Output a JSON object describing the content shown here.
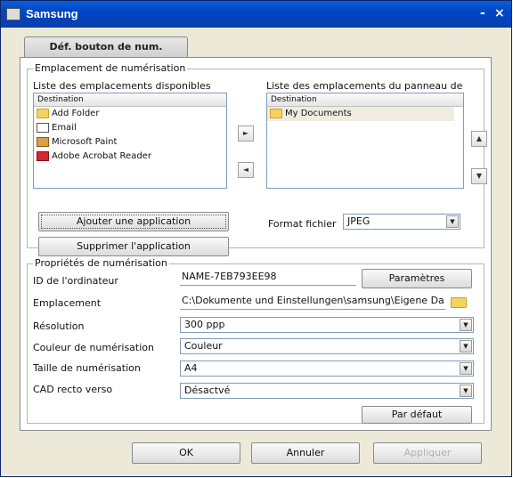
{
  "window": {
    "title": "Samsung",
    "minimize": "-",
    "close": "×"
  },
  "tab": {
    "label": "Déf. bouton de num."
  },
  "scan_location": {
    "legend": "Emplacement de numérisation",
    "available_label": "Liste des emplacements disponibles",
    "panel_label": "Liste des emplacements du panneau de",
    "column_header": "Destination",
    "available_items": [
      {
        "label": "Add Folder",
        "icon": "folder-icon"
      },
      {
        "label": "Email",
        "icon": "mail-icon"
      },
      {
        "label": "Microsoft Paint",
        "icon": "paint-icon"
      },
      {
        "label": "Adobe Acrobat Reader",
        "icon": "pdf-icon"
      }
    ],
    "panel_items": [
      {
        "label": "My Documents",
        "icon": "folder-icon"
      }
    ],
    "move_right": "►",
    "move_left": "◄",
    "move_up": "▲",
    "move_down": "▼",
    "add_app": "Ajouter une application",
    "remove_app": "Supprimer l'application",
    "format_label": "Format fichier",
    "format_value": "JPEG"
  },
  "properties": {
    "legend": "Propriétés de numérisation",
    "computer_id_label": "ID de l'ordinateur",
    "computer_id_value": "NAME-7EB793EE98",
    "settings_button": "Paramètres",
    "location_label": "Emplacement",
    "location_value": "C:\\Dokumente und Einstellungen\\samsung\\Eigene Da",
    "resolution_label": "Résolution",
    "resolution_value": "300 ppp",
    "color_label": "Couleur de numérisation",
    "color_value": "Couleur",
    "size_label": "Taille de numérisation",
    "size_value": "A4",
    "duplex_label": "CAD recto verso",
    "duplex_value": "Désactvé",
    "default_button": "Par défaut"
  },
  "footer": {
    "ok": "OK",
    "cancel": "Annuler",
    "apply": "Appliquer"
  }
}
